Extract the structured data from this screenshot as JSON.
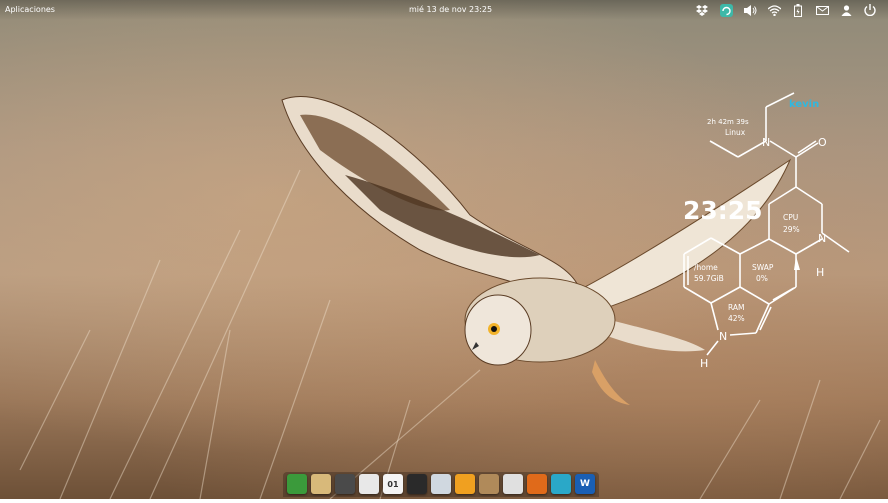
{
  "topbar": {
    "apps_label": "Aplicaciones",
    "datetime": "mié 13 de nov 23:25"
  },
  "indicators": [
    {
      "icon": "dropbox-icon"
    },
    {
      "icon": "update-icon"
    },
    {
      "icon": "volume-icon"
    },
    {
      "icon": "wifi-icon"
    },
    {
      "icon": "battery-icon"
    },
    {
      "icon": "mail-icon"
    },
    {
      "icon": "user-icon"
    },
    {
      "icon": "power-icon"
    }
  ],
  "conky": {
    "username": "kevin",
    "uptime": "2h 42m 39s",
    "os": "Linux",
    "time": "23:25",
    "cpu_label": "CPU",
    "cpu_value": "29%",
    "home_label": "/home",
    "home_value": "59.7GiB",
    "swap_label": "SWAP",
    "swap_value": "0%",
    "ram_label": "RAM",
    "ram_value": "42%",
    "atom_n": "N",
    "atom_o": "O",
    "atom_h": "H",
    "accent_color": "#2fb8e0"
  },
  "dock": [
    {
      "name": "software-center",
      "color": "#3b9a3b",
      "glyph": ""
    },
    {
      "name": "notes",
      "color": "#d8b97a",
      "glyph": ""
    },
    {
      "name": "settings",
      "color": "#4a4a4a",
      "glyph": ""
    },
    {
      "name": "chat",
      "color": "#e8e8e8",
      "glyph": ""
    },
    {
      "name": "calendar",
      "color": "#f4f4f4",
      "glyph": "01"
    },
    {
      "name": "video",
      "color": "#2a2a2a",
      "glyph": ""
    },
    {
      "name": "photos",
      "color": "#d0d8e0",
      "glyph": ""
    },
    {
      "name": "rss",
      "color": "#f0a020",
      "glyph": ""
    },
    {
      "name": "archive",
      "color": "#b08a5a",
      "glyph": ""
    },
    {
      "name": "files",
      "color": "#e0e0e0",
      "glyph": ""
    },
    {
      "name": "firefox",
      "color": "#e06a1a",
      "glyph": ""
    },
    {
      "name": "monitor",
      "color": "#2aa8c8",
      "glyph": ""
    },
    {
      "name": "writer",
      "color": "#1a5fb4",
      "glyph": "W"
    }
  ]
}
